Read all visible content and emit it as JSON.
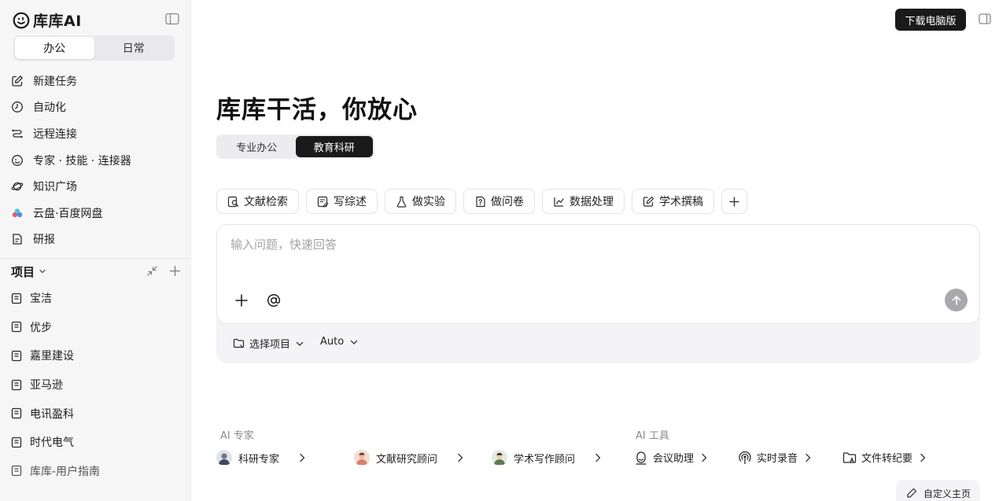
{
  "brand": {
    "name": "库库AI"
  },
  "sidebar": {
    "tabs": [
      {
        "label": "办公",
        "active": true
      },
      {
        "label": "日常",
        "active": false
      }
    ],
    "menu": [
      {
        "label": "新建任务",
        "icon": "edit-icon"
      },
      {
        "label": "自动化",
        "icon": "clock-icon"
      },
      {
        "label": "远程连接",
        "icon": "route-icon"
      },
      {
        "label": "专家 · 技能 · 连接器",
        "icon": "smile-icon"
      },
      {
        "label": "知识广场",
        "icon": "planet-icon"
      },
      {
        "label": "云盘·百度网盘",
        "icon": "cloud-drive-icon"
      },
      {
        "label": "研报",
        "icon": "report-icon"
      }
    ],
    "projects_title": "项目",
    "projects": [
      "宝洁",
      "优步",
      "嘉里建设",
      "亚马逊",
      "电讯盈科",
      "时代电气",
      "库库-用户指南"
    ]
  },
  "header": {
    "download_label": "下载电脑版"
  },
  "main": {
    "hero_title": "库库干活，你放心",
    "modes": [
      {
        "label": "专业办公",
        "active": false
      },
      {
        "label": "教育科研",
        "active": true
      }
    ],
    "chips": [
      {
        "label": "文献检索",
        "icon": "literature-search-icon"
      },
      {
        "label": "写综述",
        "icon": "write-review-icon"
      },
      {
        "label": "做实验",
        "icon": "flask-icon"
      },
      {
        "label": "做问卷",
        "icon": "questionnaire-icon"
      },
      {
        "label": "数据处理",
        "icon": "chart-line-icon"
      },
      {
        "label": "学术撰稿",
        "icon": "pen-paper-icon"
      }
    ],
    "composer": {
      "placeholder": "输入问题，快速回答",
      "project_select_label": "选择项目",
      "model_label": "Auto"
    },
    "experts_label": "AI 专家",
    "experts": [
      {
        "label": "科研专家",
        "avatar_color": "#6b7a8f"
      },
      {
        "label": "文献研究顾问",
        "avatar_color": "#d9826a"
      },
      {
        "label": "学术写作顾问",
        "avatar_color": "#5d7b58"
      }
    ],
    "tools_label": "AI 工具",
    "tools": [
      {
        "label": "会议助理",
        "icon": "meeting-assistant-icon"
      },
      {
        "label": "实时录音",
        "icon": "broadcast-icon"
      },
      {
        "label": "文件转纪要",
        "icon": "folder-text-icon"
      }
    ],
    "customize_label": "自定义主页"
  }
}
